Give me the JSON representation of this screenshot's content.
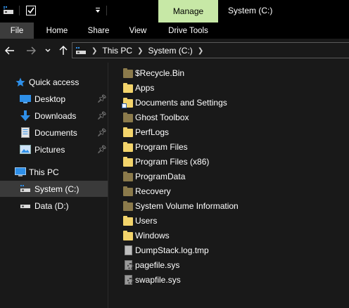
{
  "window": {
    "title": "System (C:)",
    "manage_tab": "Manage"
  },
  "ribbon": {
    "tabs": [
      "File",
      "Home",
      "Share",
      "View",
      "Drive Tools"
    ]
  },
  "address": {
    "breadcrumbs": [
      "This PC",
      "System (C:)"
    ]
  },
  "sidebar": {
    "quick_access": "Quick access",
    "pinned": [
      "Desktop",
      "Downloads",
      "Documents",
      "Pictures"
    ],
    "this_pc": "This PC",
    "drives": [
      "System (C:)",
      "Data (D:)"
    ],
    "selected": "System (C:)"
  },
  "files": [
    {
      "name": "$Recycle.Bin",
      "icon": "folder-hidden-icon"
    },
    {
      "name": "Apps",
      "icon": "folder-icon"
    },
    {
      "name": "Documents and Settings",
      "icon": "folder-shortcut-icon"
    },
    {
      "name": "Ghost Toolbox",
      "icon": "folder-hidden-icon"
    },
    {
      "name": "PerfLogs",
      "icon": "folder-icon"
    },
    {
      "name": "Program Files",
      "icon": "folder-icon"
    },
    {
      "name": "Program Files (x86)",
      "icon": "folder-icon"
    },
    {
      "name": "ProgramData",
      "icon": "folder-hidden-icon"
    },
    {
      "name": "Recovery",
      "icon": "folder-hidden-icon"
    },
    {
      "name": "System Volume Information",
      "icon": "folder-hidden-icon"
    },
    {
      "name": "Users",
      "icon": "folder-icon"
    },
    {
      "name": "Windows",
      "icon": "folder-icon"
    },
    {
      "name": "DumpStack.log.tmp",
      "icon": "file-icon"
    },
    {
      "name": "pagefile.sys",
      "icon": "system-file-icon"
    },
    {
      "name": "swapfile.sys",
      "icon": "system-file-icon"
    }
  ],
  "colors": {
    "manage_tab_bg": "#c7e8a6",
    "folder": "#f3d46b",
    "folder_hidden": "#8b7a4b",
    "selected_bg": "#3a3a3a",
    "quick_access_star": "#2e8fe8"
  }
}
